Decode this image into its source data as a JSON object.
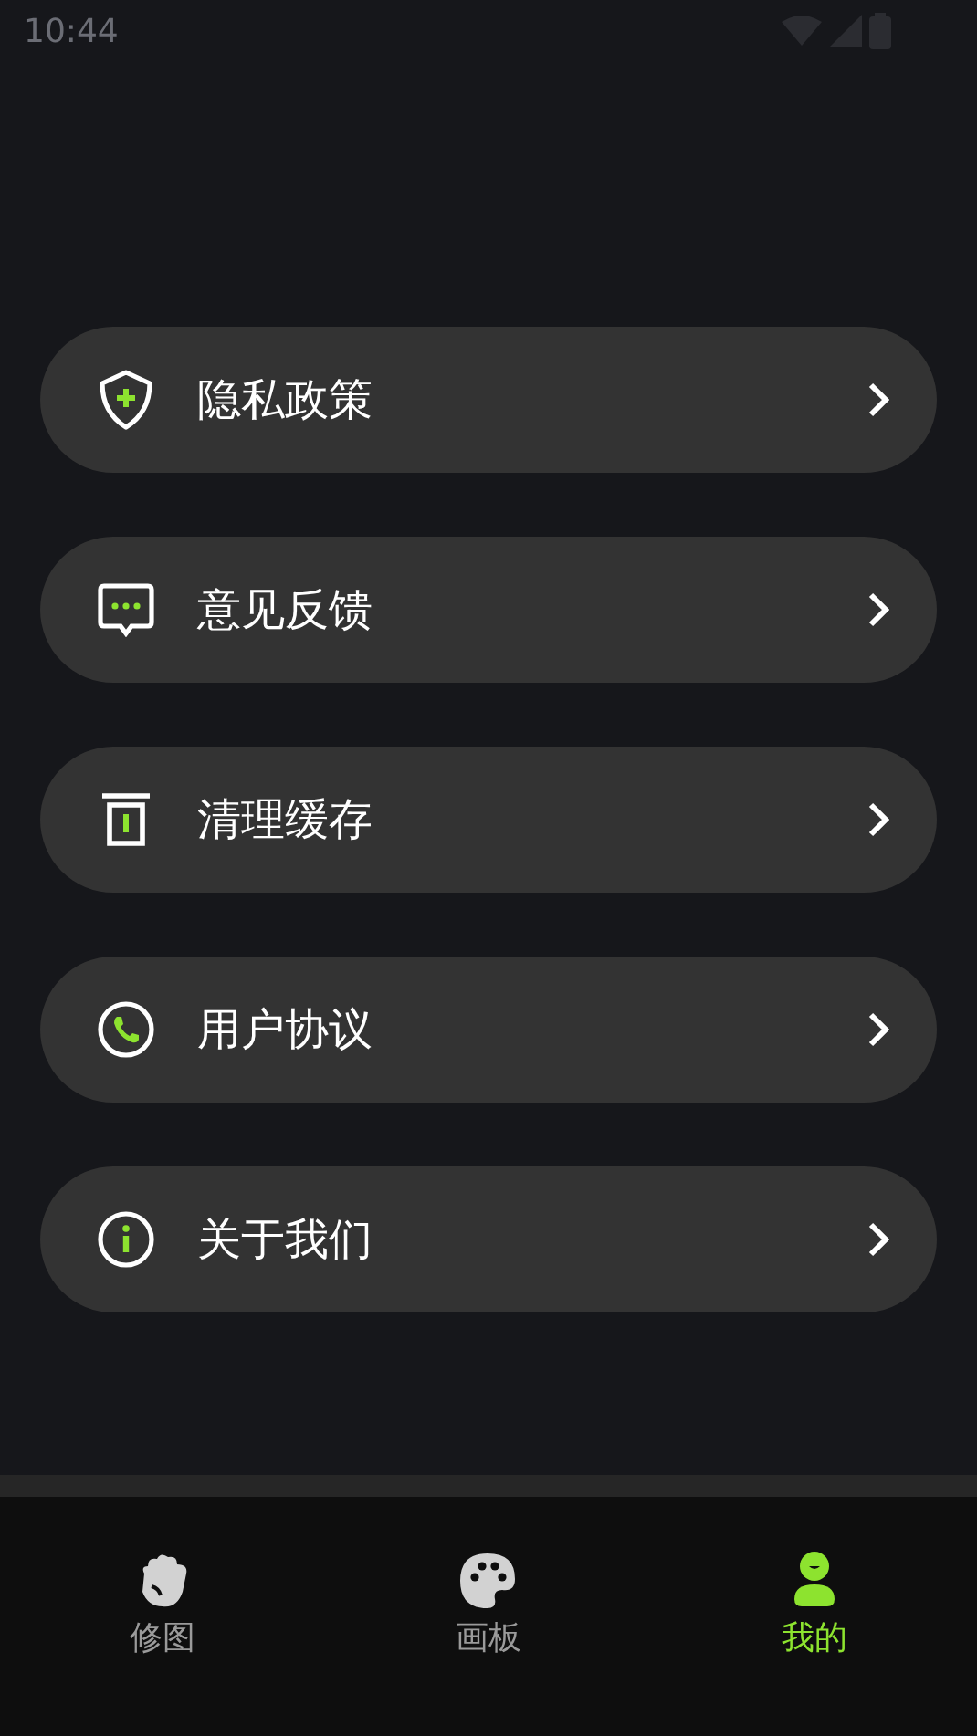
{
  "status_bar": {
    "time": "10:44"
  },
  "menu_items": [
    {
      "kind": "shield",
      "label": "隐私政策"
    },
    {
      "kind": "message",
      "label": "意见反馈"
    },
    {
      "kind": "trash",
      "label": "清理缓存"
    },
    {
      "kind": "phone",
      "label": "用户协议"
    },
    {
      "kind": "info",
      "label": "关于我们"
    }
  ],
  "tabs": [
    {
      "kind": "hand",
      "label": "修图",
      "selected": false
    },
    {
      "kind": "palette",
      "label": "画板",
      "selected": false
    },
    {
      "kind": "person",
      "label": "我的",
      "selected": true
    }
  ]
}
